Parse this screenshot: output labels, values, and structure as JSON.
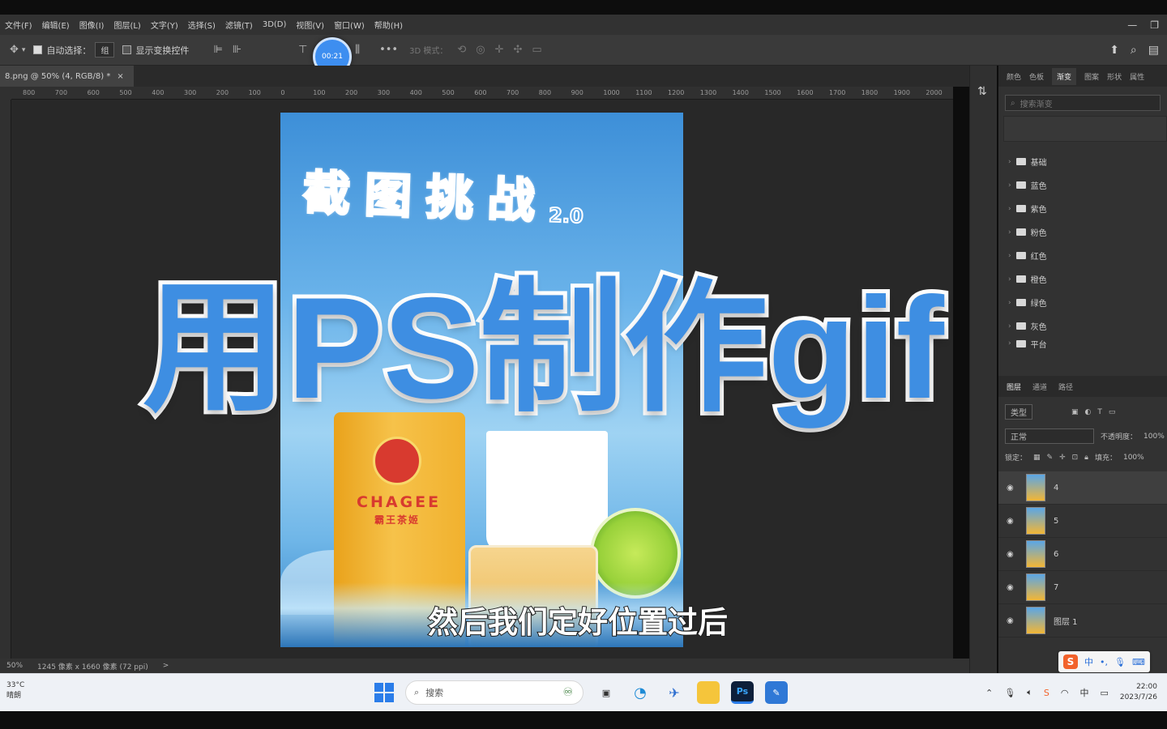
{
  "menubar": {
    "items": [
      "文件(F)",
      "编辑(E)",
      "图像(I)",
      "图层(L)",
      "文字(Y)",
      "选择(S)",
      "滤镜(T)",
      "3D(D)",
      "视图(V)",
      "窗口(W)",
      "帮助(H)"
    ],
    "window_controls": [
      "—",
      "❐"
    ]
  },
  "options": {
    "auto_select_label": "自动选择：",
    "auto_select_value": "组",
    "show_transform_label": "显示变换控件",
    "mode_3d_label": "3D 模式："
  },
  "recording_timer": "00:21",
  "document_tab": {
    "title": "8.png @ 50% (4, RGB/8) *",
    "close": "×"
  },
  "ruler_ticks": [
    "800",
    "700",
    "600",
    "500",
    "400",
    "300",
    "200",
    "100",
    "0",
    "100",
    "200",
    "300",
    "400",
    "500",
    "600",
    "700",
    "800",
    "900",
    "1000",
    "1100",
    "1200",
    "1300",
    "1400",
    "1500",
    "1600",
    "1700",
    "1800",
    "1900",
    "2000"
  ],
  "statusbar": {
    "zoom": "50%",
    "doc_info": "1245 像素 x 1660 像素 (72 ppi)",
    "arrow": ">"
  },
  "swatches_panel": {
    "tabs": [
      "颜色",
      "色板",
      "渐变",
      "图案",
      "形状",
      "属性"
    ],
    "active_tab": "渐变",
    "search_placeholder": "搜索渐变",
    "folders": [
      "基础",
      "蓝色",
      "紫色",
      "粉色",
      "红色",
      "橙色",
      "绿色",
      "灰色",
      "平台"
    ]
  },
  "layers_panel": {
    "tabs": [
      "图层",
      "通道",
      "路径"
    ],
    "kind_filter": "类型",
    "blend_mode": "正常",
    "opacity_label": "不透明度：",
    "opacity_value": "100%",
    "lock_label": "锁定：",
    "fill_label": "填充：",
    "fill_value": "100%",
    "layers": [
      {
        "name": "4",
        "selected": true
      },
      {
        "name": "5",
        "selected": false
      },
      {
        "name": "6",
        "selected": false
      },
      {
        "name": "7",
        "selected": false
      },
      {
        "name": "图层 1",
        "selected": false
      }
    ]
  },
  "poster": {
    "title_chars": [
      "截",
      "图",
      "挑",
      "战"
    ],
    "version": "2.0",
    "brand": "CHAGEE",
    "brand_cn": "霸王茶姬"
  },
  "overlay": {
    "big_title": "用PS制作gif",
    "subtitle": "然后我们定好位置过后"
  },
  "ime": {
    "logo": "S",
    "lang": "中"
  },
  "taskbar": {
    "weather_temp": "33°C",
    "weather_desc": "晴朗",
    "search_placeholder": "搜索",
    "time": "22:00",
    "date": "2023/7/26",
    "tray_lang": "中"
  },
  "colors": {
    "title_blue": "#3e8ee2",
    "ps_bg": "#282828",
    "accent": "#2b7de9"
  }
}
